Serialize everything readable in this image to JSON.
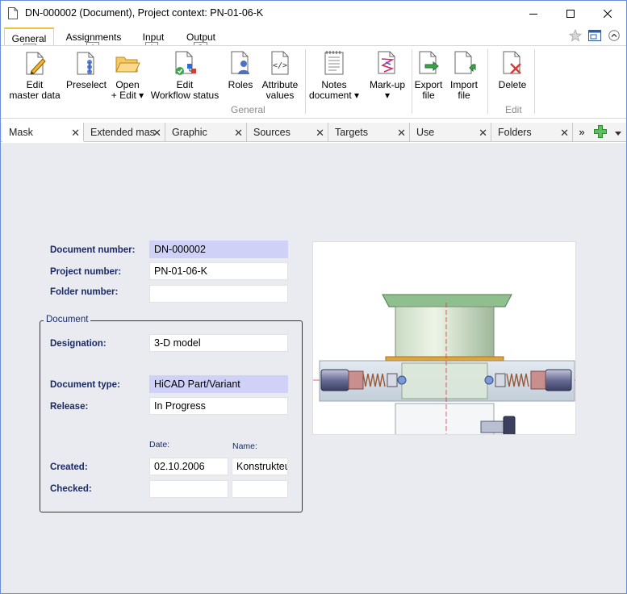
{
  "window": {
    "title": "DN-000002 (Document), Project context: PN-01-06-K"
  },
  "ribbon_tabs": [
    {
      "label": "General",
      "keytip": "S"
    },
    {
      "label": "Assignments",
      "keytip": "A"
    },
    {
      "label": "Input",
      "keytip": "I"
    },
    {
      "label": "Output",
      "keytip": "O"
    }
  ],
  "ribbon": {
    "buttons": [
      {
        "label": "Edit\nmaster data",
        "icon": "edit-master-data-icon"
      },
      {
        "label": "Preselect",
        "icon": "preselect-icon"
      },
      {
        "label": "Open\n+ Edit ▾",
        "icon": "folder-open-icon"
      },
      {
        "label": "Edit\nWorkflow status",
        "icon": "workflow-status-icon"
      },
      {
        "label": "Roles",
        "icon": "roles-icon"
      },
      {
        "label": "Attribute\nvalues",
        "icon": "attribute-values-icon"
      },
      {
        "label": "Notes\ndocument ▾",
        "icon": "notes-icon"
      },
      {
        "label": "Mark-up\n▾",
        "icon": "markup-icon"
      },
      {
        "label": "Export\nfile",
        "icon": "export-file-icon"
      },
      {
        "label": "Import\nfile",
        "icon": "import-file-icon"
      },
      {
        "label": "Delete",
        "icon": "delete-icon"
      }
    ],
    "groups": {
      "general": "General",
      "edit": "Edit"
    }
  },
  "doc_tabs": [
    {
      "label": "Mask",
      "active": true
    },
    {
      "label": "Extended mas",
      "active": false
    },
    {
      "label": "Graphic",
      "active": false
    },
    {
      "label": "Sources",
      "active": false
    },
    {
      "label": "Targets",
      "active": false
    },
    {
      "label": "Use",
      "active": false
    },
    {
      "label": "Folders",
      "active": false
    }
  ],
  "overflow_label": "»",
  "form": {
    "document_number": {
      "label": "Document number:",
      "value": "DN-000002"
    },
    "project_number": {
      "label": "Project number:",
      "value": "PN-01-06-K"
    },
    "folder_number": {
      "label": "Folder number:",
      "value": ""
    },
    "group_title": "Document",
    "designation": {
      "label": "Designation:",
      "value": "3-D model"
    },
    "document_type": {
      "label": "Document type:",
      "value": "HiCAD Part/Variant"
    },
    "release": {
      "label": "Release:",
      "value": "In Progress"
    },
    "date_header": "Date:",
    "name_header": "Name:",
    "created": {
      "label": "Created:",
      "date": "02.10.2006",
      "name": "Konstrukteur"
    },
    "checked": {
      "label": "Checked:",
      "date": "",
      "name": ""
    }
  },
  "colors": {
    "highlight_field": "#cfd2f6",
    "label_text": "#1a2a66",
    "content_bg": "#e9ebf0"
  }
}
